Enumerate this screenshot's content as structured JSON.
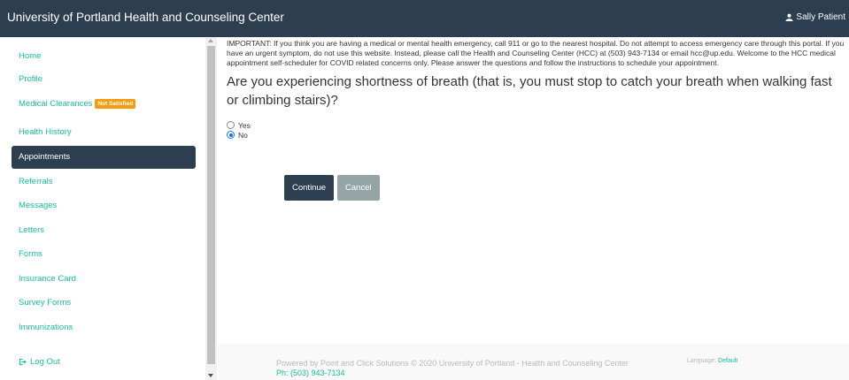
{
  "header": {
    "title": "University of Portland Health and Counseling Center",
    "user_name": "Sally Patient"
  },
  "sidebar": {
    "items": [
      {
        "label": "Home"
      },
      {
        "label": "Profile"
      },
      {
        "label": "Medical Clearances",
        "badge": "Not Satisfied"
      },
      {
        "label": "Health History"
      },
      {
        "label": "Appointments",
        "active": true
      },
      {
        "label": "Referrals"
      },
      {
        "label": "Messages"
      },
      {
        "label": "Letters"
      },
      {
        "label": "Forms"
      },
      {
        "label": "Insurance Card"
      },
      {
        "label": "Survey Forms"
      },
      {
        "label": "Immunizations"
      }
    ],
    "logout_label": "Log Out"
  },
  "main": {
    "notice": "IMPORTANT:  If you think you are having a medical or mental health emergency, call 911 or go to the nearest hospital. Do not attempt to access emergency care through this portal. If you have an urgent symptom, do not use this website. Instead, please call the Health and Counseling Center (HCC) at (503) 943-7134 or email hcc@up.edu. Welcome to the HCC medical appointment self-scheduler for COVID related concerns only. Please answer the questions and follow the instructions to schedule your appointment.",
    "question": "Are you experiencing shortness of breath (that is, you must stop to catch your breath when walking fast or climbing stairs)?",
    "options": [
      {
        "label": "Yes",
        "checked": false
      },
      {
        "label": "No",
        "checked": true
      }
    ],
    "continue_label": "Continue",
    "cancel_label": "Cancel"
  },
  "footer": {
    "powered_by": "Powered by Point and Click Solutions © 2020 University of Portland - Health and Counseling Center",
    "phone": "Ph: (503) 943-7134",
    "language_label": "Language:",
    "language_value": "Default"
  },
  "colors": {
    "navbar": "#2c3e50",
    "link": "#18bc9c",
    "badge": "#f39c12",
    "cancel": "#95a5a6"
  }
}
